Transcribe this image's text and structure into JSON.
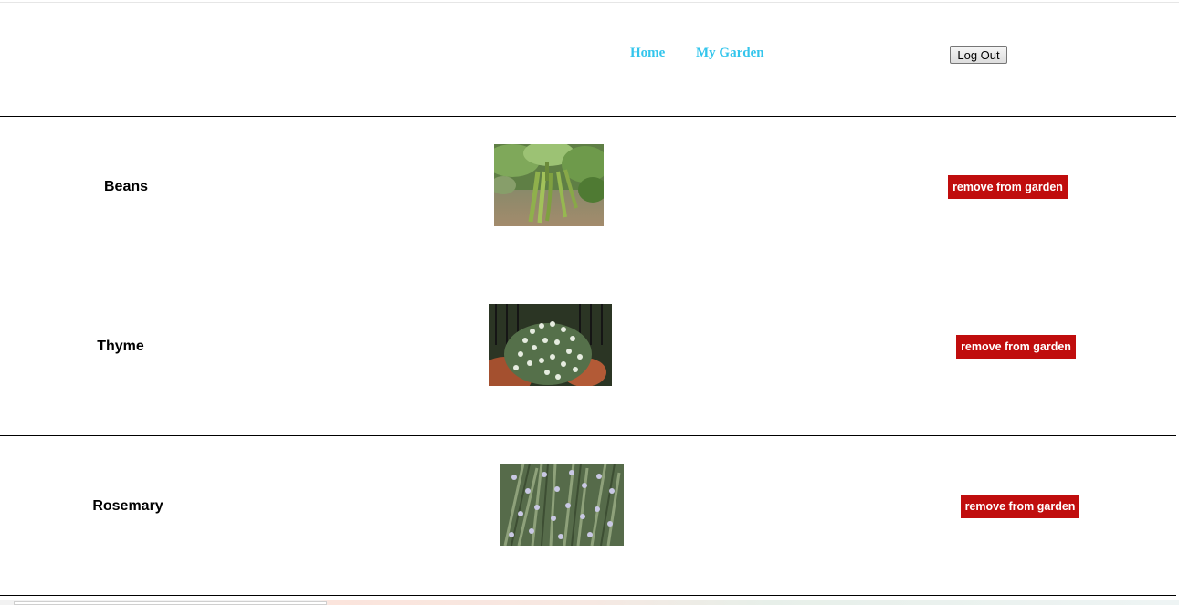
{
  "nav": {
    "home_label": "Home",
    "my_garden_label": "My Garden",
    "logout_label": "Log Out"
  },
  "colors": {
    "nav_link": "#33c5ec",
    "remove_button": "#c00d0d"
  },
  "garden": {
    "plants": [
      {
        "name": "Beans",
        "image": "beans-photo",
        "action_label": "remove from garden"
      },
      {
        "name": "Thyme",
        "image": "thyme-photo",
        "action_label": "remove from garden"
      },
      {
        "name": "Rosemary",
        "image": "rosemary-photo",
        "action_label": "remove from garden"
      }
    ]
  }
}
